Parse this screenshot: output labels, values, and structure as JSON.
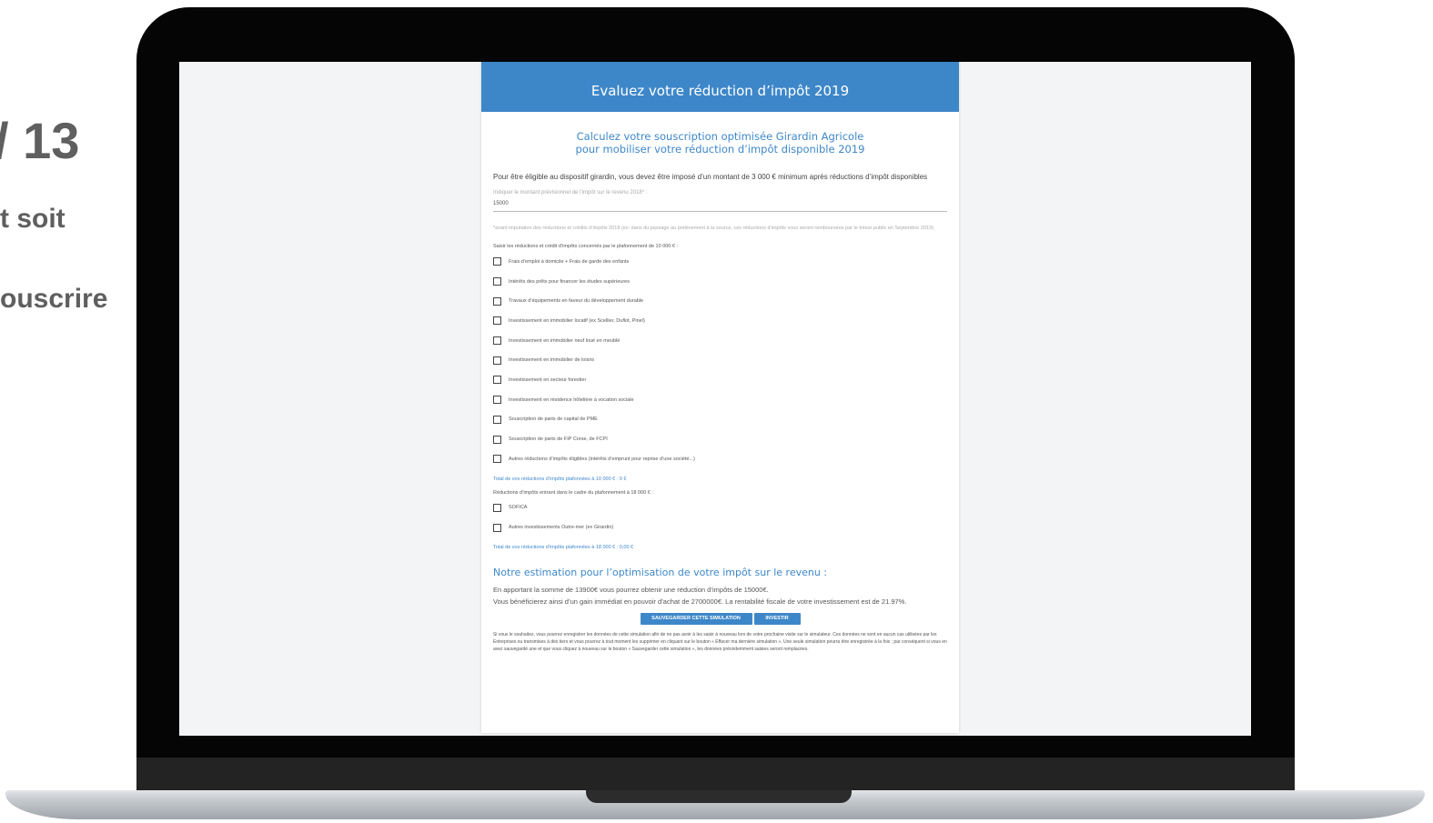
{
  "slide": {
    "number": "/ 13",
    "line1": "t soit",
    "line2": "ouscrire"
  },
  "form": {
    "header_title": "Evaluez votre réduction d’impôt 2019",
    "subtitle_line1": "Calculez votre souscription optimisée Girardin Agricole",
    "subtitle_line2": "pour mobiliser votre réduction d’impôt disponible 2019",
    "eligibility_text": "Pour être éligible au dispositif girardin, vous devez être imposé d’un montant de 3 000 € minimum après réductions d’impôt disponibles",
    "field_label": "Indiquer le montant prévisionnel de l’impôt sur le revenu 2018* :",
    "field_value": "15000",
    "note": "*avant imputation des réductions et crédits d’impôts 2018 (ex: dans du passage au prélèvement à la source, ces réductions d’impôts vous seront remboursées par le trésor public en Septembre 2019)",
    "section1_label": "Saisir les réductions et crédit d’impôts concernés par le plafonnement de 10 000 € :",
    "checkboxes1": [
      "Frais d’emploi à domicile + Frais de garde des enfants",
      "Intérêts des prêts pour financer les études supérieures",
      "Travaux d’équipements en faveur du développement durable",
      "Investissement en immobilier locatif (ex Scellier, Duflot, Pinel)",
      "Investissement en immobilier neuf loué en meublé",
      "Investissement en immobilier de loisirs",
      "Investissement en secteur forestier",
      "Investissement en résidence hôtelière à vocation sociale",
      "Souscription de parts de capital de PME",
      "Souscription de parts de FIP Corse, de FCPI",
      "Autres réductions d’impôts éligibles (intérêts d’emprunt pour reprise d’une société...)"
    ],
    "total1": "Total de vos réductions d’impôts plafonnées à 10 000 € : 0 €",
    "section2_label": "Réductions d’impôts entrant dans le cadre du plafonnement à 18 000 € :",
    "checkboxes2": [
      "SOFICA",
      "Autres investissements Outre-mer (ex Girardin)"
    ],
    "total2": "Total de vos réductions d’impôts plafonnées à 18 000 € : 0,00 €",
    "estimate_title": "Notre estimation pour l’optimisation de votre impôt sur le revenu :",
    "estimate_line1": "En apportant la somme de 13900€ vous pourrez obtenir une réduction d’impôts de 15000€.",
    "estimate_line2": "Vous bénéficierez ainsi d’un gain immédiat en pouvoir d’achat de 2700000€. La rentabilité fiscale de votre investissement est de 21.97%.",
    "save_button": "SAUVEGARDER CETTE SIMULATION",
    "invest_button": "INVESTIR",
    "legal_text": "Si vous le souhaitez, vous pourrez enregistrer les données de cette simulation afin de ne pas avoir à les saisir à nouveau lors de votre prochaine visite sur le simulateur. Ces données ne sont en aucun cas utilisées par les Entreprises ou transmises à des tiers et vous pourrez à tout moment les supprimer en cliquant sur le bouton « Effacer ma dernière simulation ». Une seule simulation pourra être enregistrée à la fois ; par conséquent si vous en avez sauvegardé une et que vous cliquez à nouveau sur le bouton « Sauvegarder cette simulation », les données précédemment saisies seront remplacées."
  }
}
